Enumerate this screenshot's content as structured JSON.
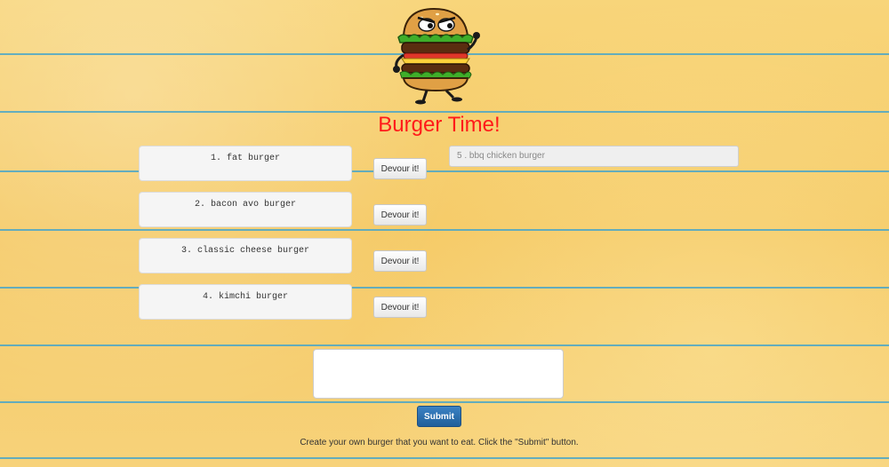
{
  "page": {
    "title": "Burger Time!",
    "title_color": "#ff1a1a"
  },
  "mascot": {
    "icon": "burger-mascot-icon"
  },
  "burgers": [
    {
      "label": "1. fat burger",
      "devour_label": "Devour it!"
    },
    {
      "label": "2. bacon avo burger",
      "devour_label": "Devour it!"
    },
    {
      "label": "3. classic cheese burger",
      "devour_label": "Devour it!"
    },
    {
      "label": "4. kimchi burger",
      "devour_label": "Devour it!"
    }
  ],
  "devoured": [
    {
      "label": "5 . bbq chicken burger"
    }
  ],
  "form": {
    "input_value": "",
    "submit_label": "Submit",
    "submit_color": "#215f9a",
    "instructions": "Create your own burger that you want to eat. Click the \"Submit\" button."
  }
}
